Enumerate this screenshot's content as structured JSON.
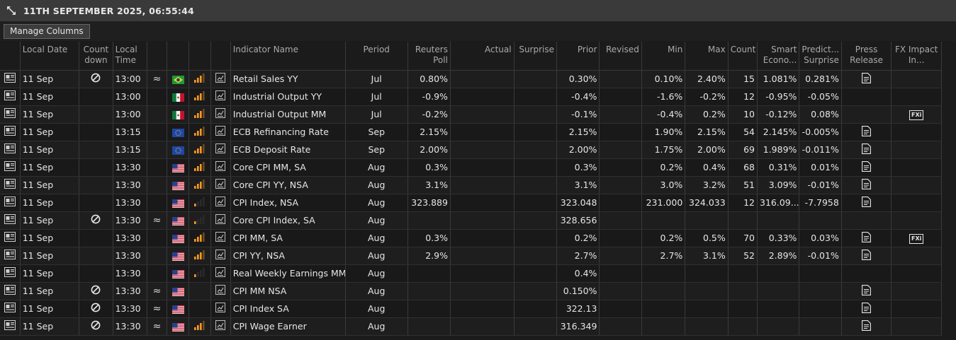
{
  "window": {
    "title": "11TH SEPTEMBER 2025, 06:55:44",
    "expand_icon": "expand-arrows-icon"
  },
  "toolbar": {
    "manage_columns_label": "Manage Columns"
  },
  "columns": {
    "local_date": "Local Date",
    "countdown": "Count down",
    "local_time": "Local Time",
    "indicator_name": "Indicator Name",
    "period": "Period",
    "reuters_poll": "Reuters Poll",
    "actual": "Actual",
    "surprise": "Surprise",
    "prior": "Prior",
    "revised": "Revised",
    "min": "Min",
    "max": "Max",
    "count": "Count",
    "smart_econ": "Smart Econo...",
    "predict_surprise": "Predict... Surprise",
    "press_release": "Press Release",
    "fx_impact": "FX Impact In..."
  },
  "fx_badge_label": "FXi",
  "colors": {
    "poll": "#3e9bff",
    "smart": "#d24bff",
    "importance_high": "#ff9a1f"
  },
  "rows": [
    {
      "date": "11 Sep",
      "countdown": true,
      "time": "13:00",
      "approx": true,
      "flag": "BR",
      "importance": 3,
      "name": "Retail Sales YY",
      "period": "Jul",
      "poll": "0.80%",
      "actual": "",
      "surprise": "",
      "prior": "0.30%",
      "revised": "",
      "min": "0.10%",
      "max": "2.40%",
      "count": "15",
      "smart": "1.081%",
      "predict": "0.281%",
      "press": true,
      "fx": false
    },
    {
      "date": "11 Sep",
      "countdown": false,
      "time": "13:00",
      "approx": false,
      "flag": "MX",
      "importance": 3,
      "name": "Industrial Output YY",
      "period": "Jul",
      "poll": "-0.9%",
      "actual": "",
      "surprise": "",
      "prior": "-0.4%",
      "revised": "",
      "min": "-1.6%",
      "max": "-0.2%",
      "count": "12",
      "smart": "-0.95%",
      "predict": "-0.05%",
      "press": false,
      "fx": false
    },
    {
      "date": "11 Sep",
      "countdown": false,
      "time": "13:00",
      "approx": false,
      "flag": "MX",
      "importance": 3,
      "name": "Industrial Output MM",
      "period": "Jul",
      "poll": "-0.2%",
      "actual": "",
      "surprise": "",
      "prior": "-0.1%",
      "revised": "",
      "min": "-0.4%",
      "max": "0.2%",
      "count": "10",
      "smart": "-0.12%",
      "predict": "0.08%",
      "press": false,
      "fx": true
    },
    {
      "date": "11 Sep",
      "countdown": false,
      "time": "13:15",
      "approx": false,
      "flag": "EU",
      "importance": 3,
      "name": "ECB Refinancing Rate",
      "period": "Sep",
      "poll": "2.15%",
      "actual": "",
      "surprise": "",
      "prior": "2.15%",
      "revised": "",
      "min": "1.90%",
      "max": "2.15%",
      "count": "54",
      "smart": "2.145%",
      "predict": "-0.005%",
      "press": true,
      "fx": false
    },
    {
      "date": "11 Sep",
      "countdown": false,
      "time": "13:15",
      "approx": false,
      "flag": "EU",
      "importance": 3,
      "name": "ECB Deposit Rate",
      "period": "Sep",
      "poll": "2.00%",
      "actual": "",
      "surprise": "",
      "prior": "2.00%",
      "revised": "",
      "min": "1.75%",
      "max": "2.00%",
      "count": "69",
      "smart": "1.989%",
      "predict": "-0.011%",
      "press": true,
      "fx": false
    },
    {
      "date": "11 Sep",
      "countdown": false,
      "time": "13:30",
      "approx": false,
      "flag": "US",
      "importance": 3,
      "name": "Core CPI MM, SA",
      "period": "Aug",
      "poll": "0.3%",
      "actual": "",
      "surprise": "",
      "prior": "0.3%",
      "revised": "",
      "min": "0.2%",
      "max": "0.4%",
      "count": "68",
      "smart": "0.31%",
      "predict": "0.01%",
      "press": true,
      "fx": false
    },
    {
      "date": "11 Sep",
      "countdown": false,
      "time": "13:30",
      "approx": false,
      "flag": "US",
      "importance": 3,
      "name": "Core CPI YY, NSA",
      "period": "Aug",
      "poll": "3.1%",
      "actual": "",
      "surprise": "",
      "prior": "3.1%",
      "revised": "",
      "min": "3.0%",
      "max": "3.2%",
      "count": "51",
      "smart": "3.09%",
      "predict": "-0.01%",
      "press": true,
      "fx": false
    },
    {
      "date": "11 Sep",
      "countdown": false,
      "time": "13:30",
      "approx": false,
      "flag": "US",
      "importance": 1,
      "name": "CPI Index, NSA",
      "period": "Aug",
      "poll": "323.889",
      "actual": "",
      "surprise": "",
      "prior": "323.048",
      "revised": "",
      "min": "231.000",
      "max": "324.033",
      "count": "12",
      "smart": "316.09...",
      "predict": "-7.7958",
      "press": true,
      "fx": false
    },
    {
      "date": "11 Sep",
      "countdown": true,
      "time": "13:30",
      "approx": true,
      "flag": "US",
      "importance": 1,
      "name": "Core CPI Index, SA",
      "period": "Aug",
      "poll": "",
      "actual": "",
      "surprise": "",
      "prior": "328.656",
      "revised": "",
      "min": "",
      "max": "",
      "count": "",
      "smart": "",
      "predict": "",
      "press": false,
      "fx": false
    },
    {
      "date": "11 Sep",
      "countdown": false,
      "time": "13:30",
      "approx": false,
      "flag": "US",
      "importance": 3,
      "name": "CPI MM, SA",
      "period": "Aug",
      "poll": "0.3%",
      "actual": "",
      "surprise": "",
      "prior": "0.2%",
      "revised": "",
      "min": "0.2%",
      "max": "0.5%",
      "count": "70",
      "smart": "0.33%",
      "predict": "0.03%",
      "press": true,
      "fx": true
    },
    {
      "date": "11 Sep",
      "countdown": false,
      "time": "13:30",
      "approx": false,
      "flag": "US",
      "importance": 3,
      "name": "CPI YY, NSA",
      "period": "Aug",
      "poll": "2.9%",
      "actual": "",
      "surprise": "",
      "prior": "2.7%",
      "revised": "",
      "min": "2.7%",
      "max": "3.1%",
      "count": "52",
      "smart": "2.89%",
      "predict": "-0.01%",
      "press": true,
      "fx": false
    },
    {
      "date": "11 Sep",
      "countdown": false,
      "time": "13:30",
      "approx": false,
      "flag": "US",
      "importance": 1,
      "name": "Real Weekly Earnings MM",
      "period": "Aug",
      "poll": "",
      "actual": "",
      "surprise": "",
      "prior": "0.4%",
      "revised": "",
      "min": "",
      "max": "",
      "count": "",
      "smart": "",
      "predict": "",
      "press": false,
      "fx": false
    },
    {
      "date": "11 Sep",
      "countdown": true,
      "time": "13:30",
      "approx": true,
      "flag": "US",
      "importance": 0,
      "name": "CPI MM NSA",
      "period": "Aug",
      "poll": "",
      "actual": "",
      "surprise": "",
      "prior": "0.150%",
      "revised": "",
      "min": "",
      "max": "",
      "count": "",
      "smart": "",
      "predict": "",
      "press": true,
      "fx": false
    },
    {
      "date": "11 Sep",
      "countdown": true,
      "time": "13:30",
      "approx": true,
      "flag": "US",
      "importance": 0,
      "name": "CPI Index SA",
      "period": "Aug",
      "poll": "",
      "actual": "",
      "surprise": "",
      "prior": "322.13",
      "revised": "",
      "min": "",
      "max": "",
      "count": "",
      "smart": "",
      "predict": "",
      "press": true,
      "fx": false
    },
    {
      "date": "11 Sep",
      "countdown": true,
      "time": "13:30",
      "approx": true,
      "flag": "US",
      "importance": 3,
      "name": "CPI Wage Earner",
      "period": "Aug",
      "poll": "",
      "actual": "",
      "surprise": "",
      "prior": "316.349",
      "revised": "",
      "min": "",
      "max": "",
      "count": "",
      "smart": "",
      "predict": "",
      "press": true,
      "fx": false
    }
  ]
}
